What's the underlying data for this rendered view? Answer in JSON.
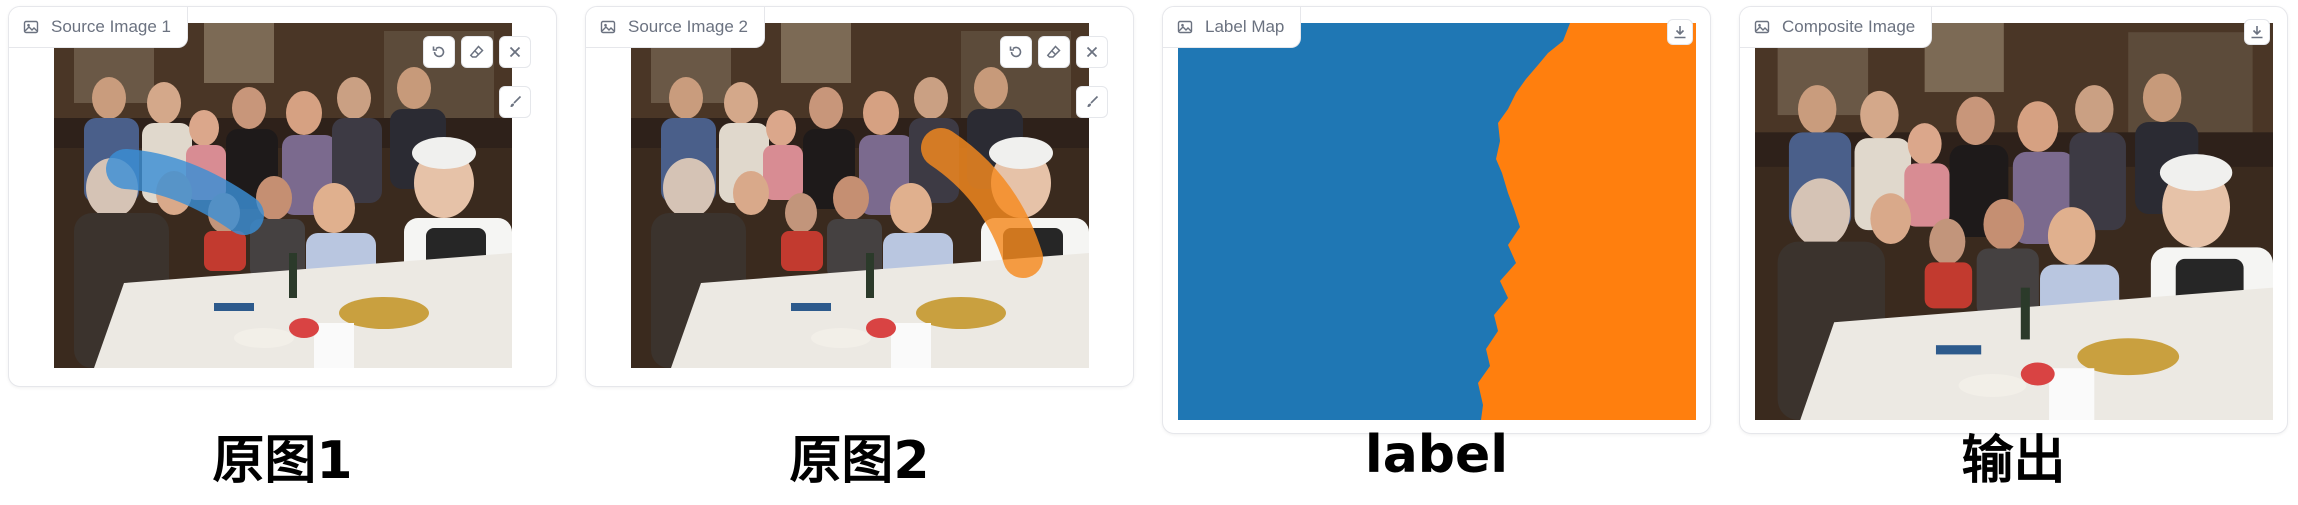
{
  "panels": [
    {
      "label": "Source Image 1",
      "tools": [
        "undo-icon",
        "eraser-icon",
        "close-icon",
        "brush-icon"
      ],
      "stroke_color": "#3b8fd6"
    },
    {
      "label": "Source Image 2",
      "tools": [
        "undo-icon",
        "eraser-icon",
        "close-icon",
        "brush-icon"
      ],
      "stroke_color": "#f58a1f"
    },
    {
      "label": "Label Map",
      "tools": [
        "download-icon"
      ],
      "colors": {
        "region_a": "#1f77b4",
        "region_b": "#ff7f0e"
      }
    },
    {
      "label": "Composite Image",
      "tools": [
        "download-icon"
      ]
    }
  ],
  "captions": [
    "原图1",
    "原图2",
    "label",
    "输出"
  ],
  "icons": {
    "badge": "image-icon"
  }
}
